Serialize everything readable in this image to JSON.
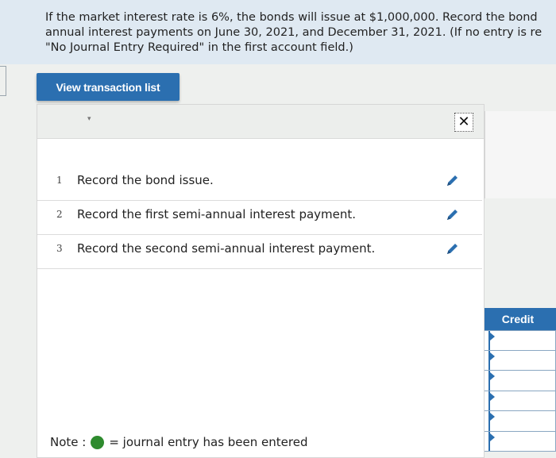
{
  "instructions": {
    "line1": "If the market interest rate is 6%, the bonds will issue at $1,000,000. Record the bond",
    "line2": "annual interest payments on June 30, 2021, and December 31, 2021. (If no entry is re",
    "line3": "\"No Journal Entry Required\" in the first account field.)"
  },
  "view_button": {
    "label": "View transaction list"
  },
  "modal": {
    "close_icon": "close-icon",
    "close_glyph": "✕",
    "transactions": [
      {
        "number": "1",
        "text": "Record the bond issue.",
        "icon": "pencil-icon"
      },
      {
        "number": "2",
        "text": "Record the first semi-annual interest payment.",
        "icon": "pencil-icon"
      },
      {
        "number": "3",
        "text": "Record the second semi-annual interest payment.",
        "icon": "pencil-icon"
      }
    ],
    "note": {
      "prefix": "Note :",
      "suffix": "= journal entry has been entered",
      "dot_color": "#2e8b2e"
    }
  },
  "journal": {
    "credit_header": "Credit",
    "rows": 6
  },
  "colors": {
    "accent": "#2b6fb0",
    "instruction_bg": "#dfe9f2"
  }
}
